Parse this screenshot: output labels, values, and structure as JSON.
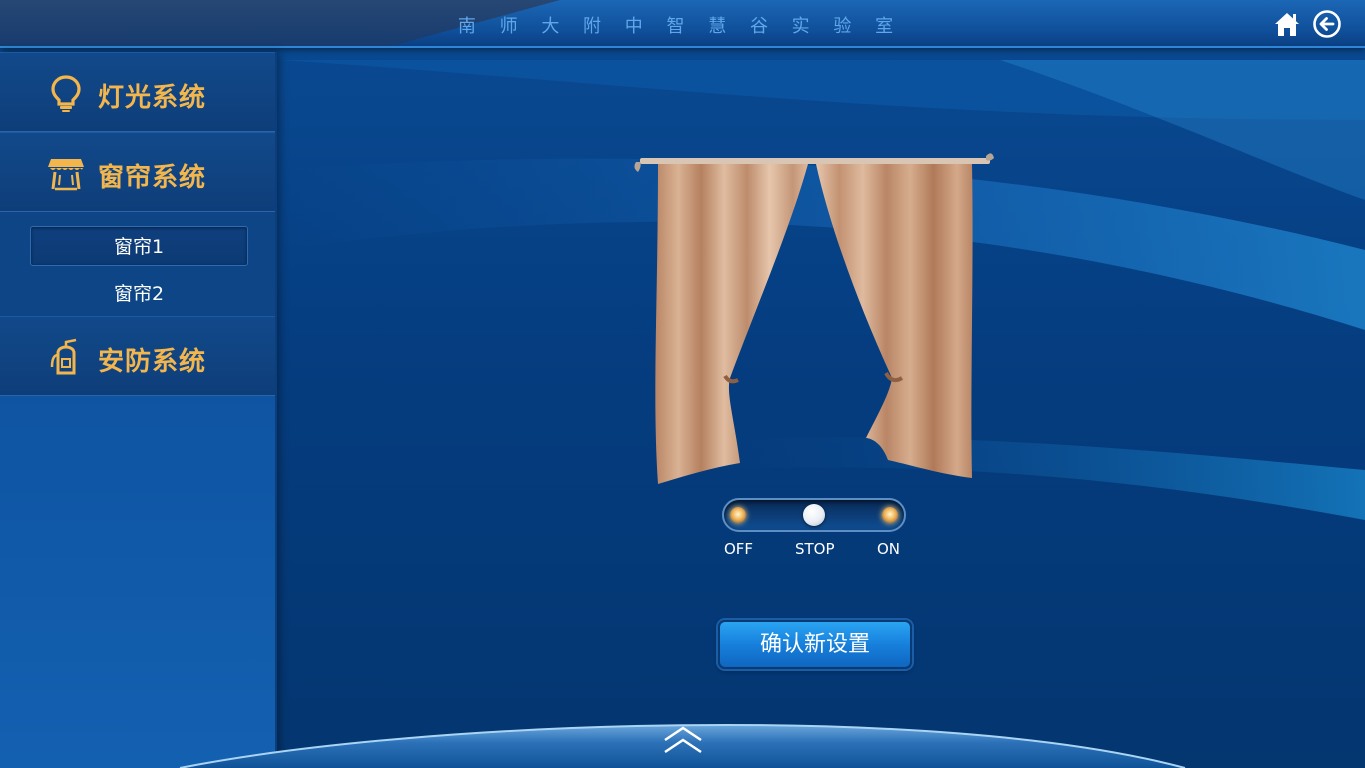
{
  "header": {
    "title": "南 师 大 附 中 智 慧 谷 实 验 室",
    "home_icon": "home-icon",
    "back_icon": "back-arrow-icon"
  },
  "sidebar": {
    "sections": [
      {
        "label": "灯光系统",
        "icon": "lightbulb-icon"
      },
      {
        "label": "窗帘系统",
        "icon": "curtain-icon"
      },
      {
        "label": "安防系统",
        "icon": "fire-extinguisher-icon"
      }
    ],
    "curtain_items": [
      {
        "label": "窗帘1",
        "selected": true
      },
      {
        "label": "窗帘2",
        "selected": false
      }
    ]
  },
  "curtain_control": {
    "switch": {
      "state": "STOP",
      "options": [
        "OFF",
        "STOP",
        "ON"
      ]
    },
    "confirm_label": "确认新设置"
  },
  "footer": {
    "expand_icon": "double-chevron-up-icon"
  },
  "colors": {
    "accent_orange": "#f3b64d",
    "title_blue": "#5fa6ea",
    "button_blue": "#1780dc",
    "background": "#063a78"
  }
}
